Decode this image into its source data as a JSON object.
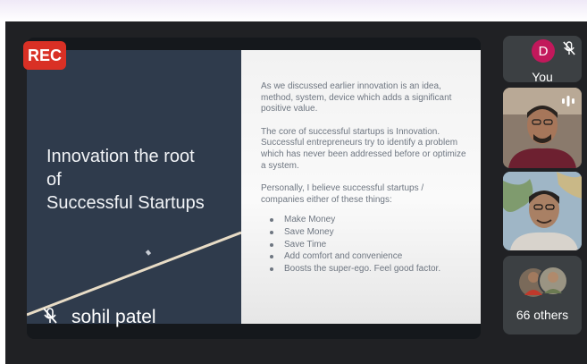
{
  "recording": {
    "badge": "REC"
  },
  "slide": {
    "title_lines": [
      "Innovation the root",
      "of",
      "Successful Startups"
    ],
    "paragraphs": [
      "As we discussed earlier innovation is an idea, method, system, device which adds a significant positive value.",
      "The core of successful startups is Innovation. Successful entrepreneurs try to identify a problem which has never been addressed before or optimize a system.",
      "Personally, I believe successful startups / companies either of these things:"
    ],
    "bullets": [
      "Make Money",
      "Save Money",
      "Save Time",
      "Add comfort and convenience",
      "Boosts the super-ego. Feel good factor."
    ],
    "left_panel_color": "#2f3b4c",
    "right_panel_color": "#f4f4f4"
  },
  "speaker": {
    "name": "sohil patel",
    "mic_icon": "mic-off-icon"
  },
  "self_tile": {
    "avatar_letter": "D",
    "label": "You",
    "avatar_color": "#c2185b",
    "mic_icon": "mic-off-icon"
  },
  "participants": [
    {
      "speaking_icon": "audio-level-icon"
    },
    {}
  ],
  "others_tile": {
    "label": "66 others"
  },
  "colors": {
    "rec": "#d93025",
    "meet_bg": "#202124",
    "tile_bg": "#3c4043"
  }
}
